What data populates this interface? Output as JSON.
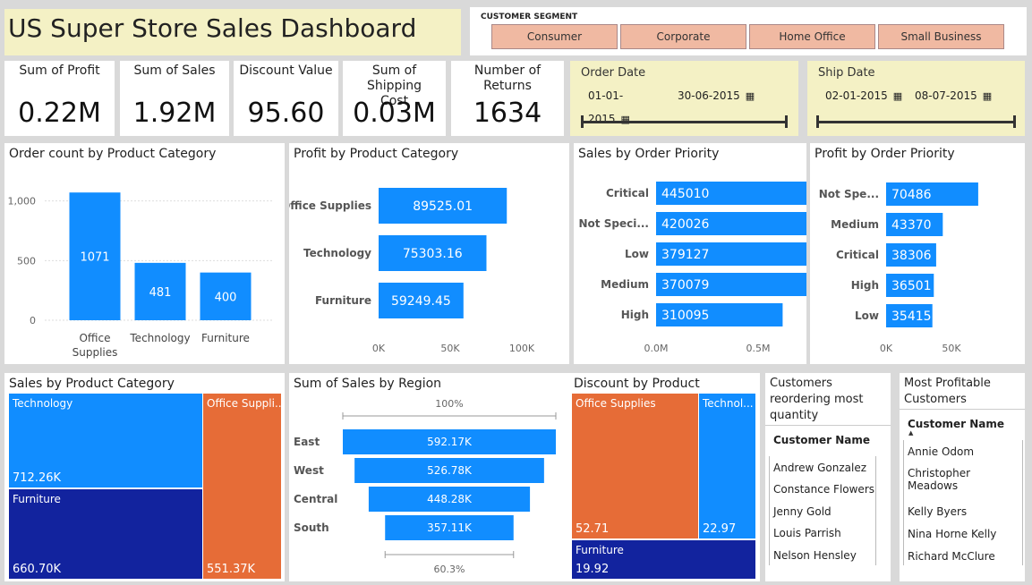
{
  "title": "US Super Store Sales Dashboard",
  "segment": {
    "label": "CUSTOMER SEGMENT",
    "options": [
      "Consumer",
      "Corporate",
      "Home Office",
      "Small Business"
    ]
  },
  "kpis": [
    {
      "label": "Sum of Profit",
      "value": "0.22M"
    },
    {
      "label": "Sum of Sales",
      "value": "1.92M"
    },
    {
      "label": "Discount Value",
      "value": "95.60"
    },
    {
      "label": "Sum of Shipping Cost",
      "value": "0.03M"
    },
    {
      "label": "Number of Returns",
      "value": "1634"
    }
  ],
  "order_date": {
    "label": "Order Date",
    "from": "01-01-2015",
    "to": "30-06-2015"
  },
  "ship_date": {
    "label": "Ship Date",
    "from": "02-01-2015",
    "to": "08-07-2015"
  },
  "colors": {
    "blue": "#118dff",
    "navy": "#12239e",
    "orange": "#e66c37",
    "yellow": "#f4f1c5",
    "button": "#f0b9a2"
  },
  "chart_data": [
    {
      "id": "order_count",
      "type": "bar",
      "title": "Order count by Product Category",
      "categories": [
        "Office Supplies",
        "Technology",
        "Furniture"
      ],
      "values": [
        1071,
        481,
        400
      ],
      "yticks": [
        "0",
        "500",
        "1,000"
      ],
      "ylim": [
        0,
        1200
      ]
    },
    {
      "id": "profit_category",
      "type": "bar",
      "orientation": "horizontal",
      "title": "Profit by Product Category",
      "categories": [
        "Office Supplies",
        "Technology",
        "Furniture"
      ],
      "values": [
        89525.01,
        75303.16,
        59249.45
      ],
      "labels": [
        "89525.01",
        "75303.16",
        "59249.45"
      ],
      "xticks": [
        "0K",
        "50K",
        "100K"
      ],
      "xlim": [
        0,
        100000
      ]
    },
    {
      "id": "sales_priority",
      "type": "bar",
      "orientation": "horizontal",
      "title": "Sales by Order Priority",
      "categories": [
        "Critical",
        "Not Speci...",
        "Low",
        "Medium",
        "High"
      ],
      "values": [
        445010,
        420026,
        379127,
        370079,
        310095
      ],
      "xticks": [
        "0.0M",
        "0.5M"
      ],
      "xlim": [
        0,
        500000
      ]
    },
    {
      "id": "profit_priority",
      "type": "bar",
      "orientation": "horizontal",
      "title": "Profit by Order Priority",
      "categories": [
        "Not Spe...",
        "Medium",
        "Critical",
        "High",
        "Low"
      ],
      "values": [
        70486,
        43370,
        38306,
        36501,
        35415
      ],
      "xticks": [
        "0K",
        "50K"
      ],
      "xlim": [
        0,
        100000
      ]
    },
    {
      "id": "sales_category_treemap",
      "type": "treemap",
      "title": "Sales by Product Category",
      "categories": [
        "Technology",
        "Furniture",
        "Office Suppli..."
      ],
      "values": [
        712.26,
        660.7,
        551.37
      ],
      "labels": [
        "712.26K",
        "660.70K",
        "551.37K"
      ]
    },
    {
      "id": "sales_region_funnel",
      "type": "funnel",
      "title": "Sum of Sales by Region",
      "categories": [
        "East",
        "West",
        "Central",
        "South"
      ],
      "values": [
        592.17,
        526.78,
        448.28,
        357.11
      ],
      "labels": [
        "592.17K",
        "526.78K",
        "448.28K",
        "357.11K"
      ],
      "top_pct": "100%",
      "bottom_pct": "60.3%"
    },
    {
      "id": "discount_category_treemap",
      "type": "treemap",
      "title": "Discount by Product Category",
      "categories": [
        "Office Supplies",
        "Technol...",
        "Furniture"
      ],
      "values": [
        52.71,
        22.97,
        19.92
      ],
      "labels": [
        "52.71",
        "22.97",
        "19.92"
      ]
    }
  ],
  "reordering": {
    "title": "Customers reordering most quantity",
    "column": "Customer Name",
    "rows": [
      "Andrew Gonzalez",
      "Constance Flowers",
      "Jenny Gold",
      "Louis Parrish",
      "Nelson Hensley"
    ]
  },
  "profitable": {
    "title": "Most Profitable Customers",
    "column": "Customer Name",
    "rows": [
      "Annie Odom",
      "Christopher Meadows",
      "Kelly Byers",
      "Nina Horne Kelly",
      "Richard McClure"
    ]
  }
}
